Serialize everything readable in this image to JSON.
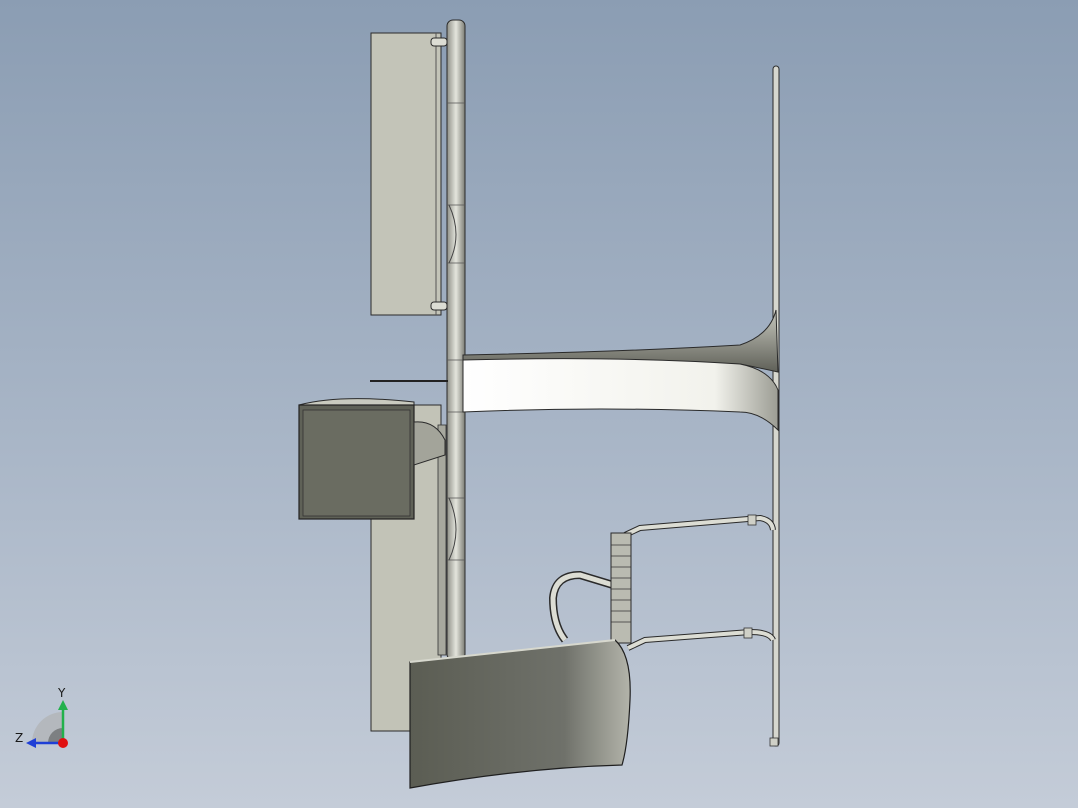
{
  "viewport": {
    "background_top": "#8b9db3",
    "background_bottom": "#c4ccd8"
  },
  "triad": {
    "y_label": "Y",
    "z_label": "Z",
    "y_color": "#22b14c",
    "z_color": "#1f3fd6",
    "x_color": "#e01010"
  },
  "colors": {
    "panel_light": "#c3c4b8",
    "panel_dark": "#6b6d62",
    "edge": "#2a2a2a",
    "metal": "#d8d9d2"
  }
}
